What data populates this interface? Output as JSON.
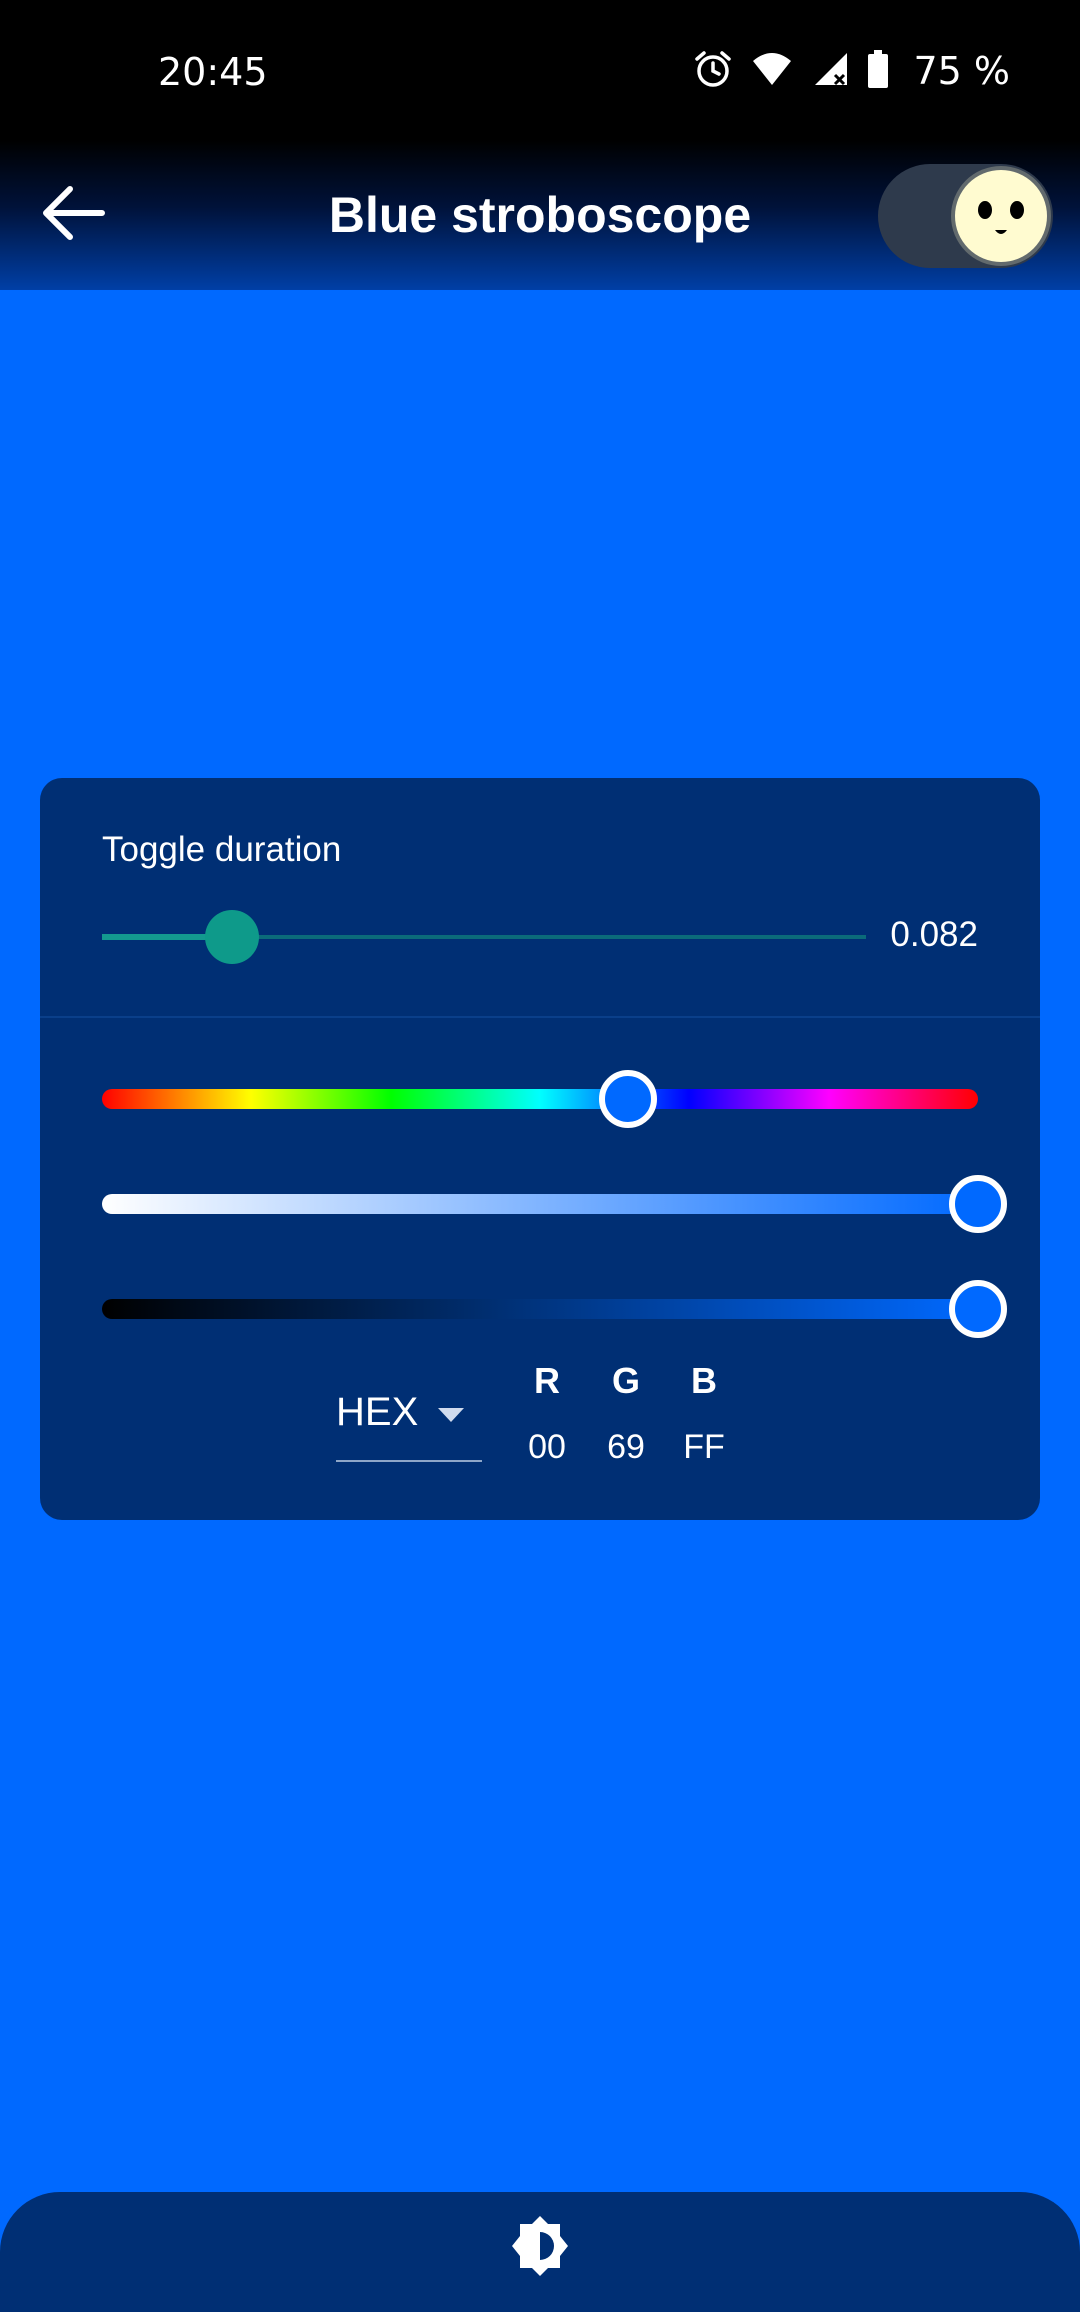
{
  "status_bar": {
    "time": "20:45",
    "battery": "75 %",
    "icons": [
      "alarm-icon",
      "wifi-icon",
      "signal-icon",
      "battery-icon"
    ]
  },
  "app_bar": {
    "title": "Blue stroboscope",
    "back_icon": "arrow-left-icon",
    "theme_toggle": {
      "state": "on",
      "knob_icon": "face-icon"
    }
  },
  "duration": {
    "label": "Toggle duration",
    "value": "0.082",
    "slider_fraction": 0.17
  },
  "color_picker": {
    "hue_fraction": 0.6,
    "saturation_fraction": 1.0,
    "value_fraction": 1.0,
    "format": "HEX",
    "channels": [
      {
        "header": "R",
        "value": "00"
      },
      {
        "header": "G",
        "value": "69"
      },
      {
        "header": "B",
        "value": "FF"
      }
    ]
  },
  "colors": {
    "background": "#0069ff",
    "panel": "#002f74",
    "accent_teal": "#0e9a8a"
  },
  "bottom_bar": {
    "brightness_icon": "brightness-icon"
  }
}
